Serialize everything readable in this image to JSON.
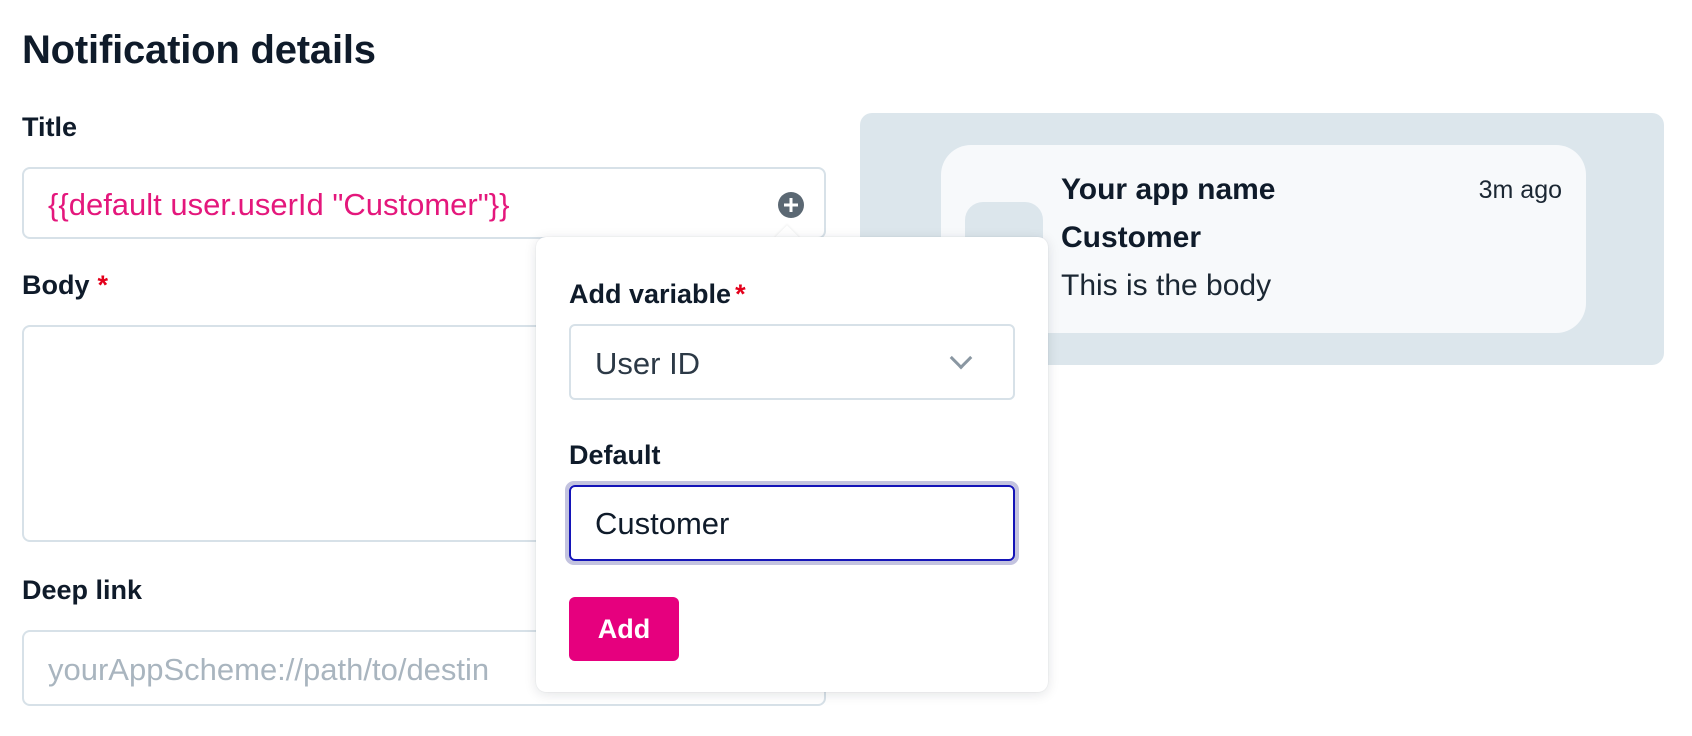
{
  "page": {
    "title": "Notification details"
  },
  "form": {
    "title_label": "Title",
    "title_value": "{{default user.userId \"Customer\"}}",
    "body_label": "Body",
    "required_mark": "*",
    "body_value": "",
    "deeplink_label": "Deep link",
    "deeplink_placeholder": "yourAppScheme://path/to/destin"
  },
  "popover": {
    "variable_label": "Add variable",
    "required_mark": "*",
    "variable_selected": "User ID",
    "default_label": "Default",
    "default_value": "Customer",
    "add_label": "Add"
  },
  "preview": {
    "app_name": "Your app name",
    "time": "3m ago",
    "title": "Customer",
    "body": "This is the body"
  },
  "colors": {
    "accent": "#e6007e",
    "variable_text": "#e4177c",
    "focus_border": "#1414b8",
    "required": "#e3001b"
  },
  "icons": {
    "insert_variable": "plus-circle-icon",
    "select_chevron": "chevron-down-icon"
  }
}
